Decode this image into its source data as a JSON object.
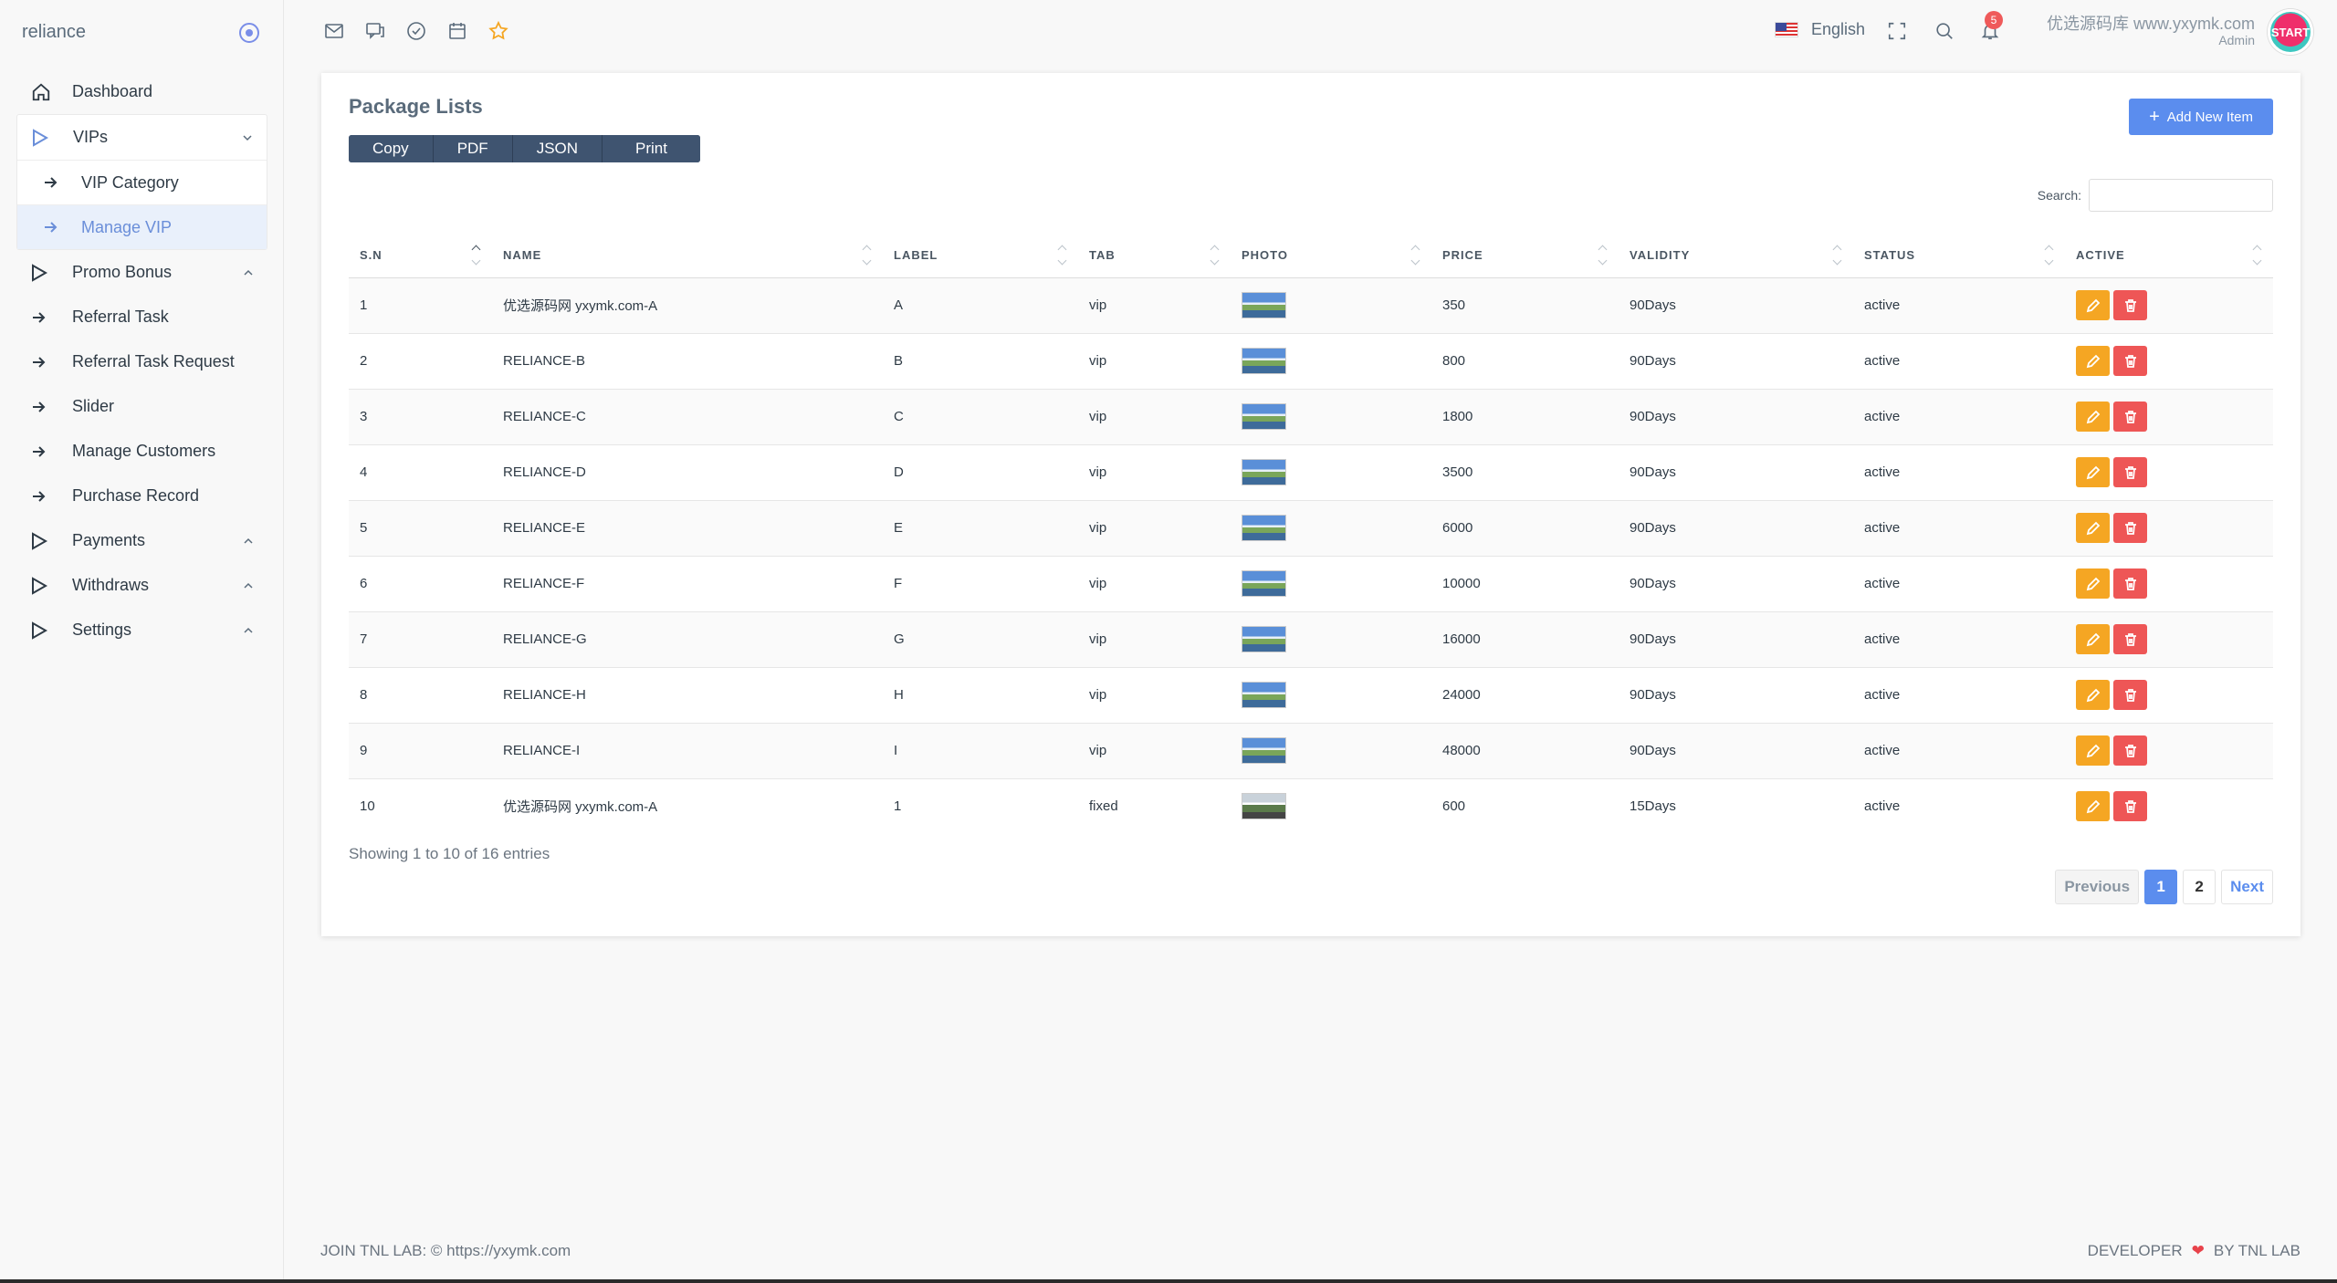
{
  "app": {
    "brand": "reliance",
    "colors": {
      "accent": "#5b8dee",
      "edit": "#f5a623",
      "delete": "#ee5656",
      "export": "#3f5470"
    }
  },
  "sidebar": {
    "items": [
      {
        "label": "Dashboard",
        "icon": "home-icon"
      },
      {
        "label": "VIPs",
        "icon": "play-outline-icon",
        "expanded": true,
        "children": [
          {
            "label": "VIP Category",
            "icon": "arrow-right-icon"
          },
          {
            "label": "Manage VIP",
            "icon": "arrow-right-icon",
            "active": true
          }
        ]
      },
      {
        "label": "Promo Bonus",
        "icon": "play-outline-icon"
      },
      {
        "label": "Referral Task",
        "icon": "arrow-right-icon"
      },
      {
        "label": "Referral Task Request",
        "icon": "arrow-right-icon"
      },
      {
        "label": "Slider",
        "icon": "arrow-right-icon"
      },
      {
        "label": "Manage Customers",
        "icon": "arrow-right-icon"
      },
      {
        "label": "Purchase Record",
        "icon": "arrow-right-icon"
      },
      {
        "label": "Payments",
        "icon": "play-outline-icon"
      },
      {
        "label": "Withdraws",
        "icon": "play-outline-icon"
      },
      {
        "label": "Settings",
        "icon": "play-outline-icon"
      }
    ]
  },
  "topbar": {
    "language": "English",
    "notification_count": "5",
    "user_name": "优选源码库 www.yxymk.com",
    "user_role": "Admin",
    "avatar_text": "START"
  },
  "card": {
    "title": "Package Lists",
    "export_buttons": [
      "Copy",
      "PDF",
      "JSON",
      "Print"
    ],
    "add_label": "Add New Item",
    "search_label": "Search:",
    "search_value": "",
    "columns": [
      "S.N",
      "NAME",
      "LABEL",
      "TAB",
      "PHOTO",
      "PRICE",
      "VALIDITY",
      "STATUS",
      "ACTIVE"
    ],
    "rows": [
      {
        "sn": "1",
        "name": "优选源码网 yxymk.com-A",
        "label": "A",
        "tab": "vip",
        "price": "350",
        "validity": "90Days",
        "status": "active"
      },
      {
        "sn": "2",
        "name": "RELIANCE-B",
        "label": "B",
        "tab": "vip",
        "price": "800",
        "validity": "90Days",
        "status": "active"
      },
      {
        "sn": "3",
        "name": "RELIANCE-C",
        "label": "C",
        "tab": "vip",
        "price": "1800",
        "validity": "90Days",
        "status": "active"
      },
      {
        "sn": "4",
        "name": "RELIANCE-D",
        "label": "D",
        "tab": "vip",
        "price": "3500",
        "validity": "90Days",
        "status": "active"
      },
      {
        "sn": "5",
        "name": "RELIANCE-E",
        "label": "E",
        "tab": "vip",
        "price": "6000",
        "validity": "90Days",
        "status": "active"
      },
      {
        "sn": "6",
        "name": "RELIANCE-F",
        "label": "F",
        "tab": "vip",
        "price": "10000",
        "validity": "90Days",
        "status": "active"
      },
      {
        "sn": "7",
        "name": "RELIANCE-G",
        "label": "G",
        "tab": "vip",
        "price": "16000",
        "validity": "90Days",
        "status": "active"
      },
      {
        "sn": "8",
        "name": "RELIANCE-H",
        "label": "H",
        "tab": "vip",
        "price": "24000",
        "validity": "90Days",
        "status": "active"
      },
      {
        "sn": "9",
        "name": "RELIANCE-I",
        "label": "I",
        "tab": "vip",
        "price": "48000",
        "validity": "90Days",
        "status": "active"
      },
      {
        "sn": "10",
        "name": "优选源码网 yxymk.com-A",
        "label": "1",
        "tab": "fixed",
        "price": "600",
        "validity": "15Days",
        "status": "active"
      }
    ],
    "entries_info": "Showing 1 to 10 of 16 entries",
    "pagination": {
      "previous": "Previous",
      "pages": [
        "1",
        "2"
      ],
      "current": "1",
      "next": "Next"
    }
  },
  "footer": {
    "left": "JOIN TNL LAB: © https://yxymk.com",
    "right_prefix": "DEVELOPER",
    "right_suffix": "BY TNL LAB"
  }
}
